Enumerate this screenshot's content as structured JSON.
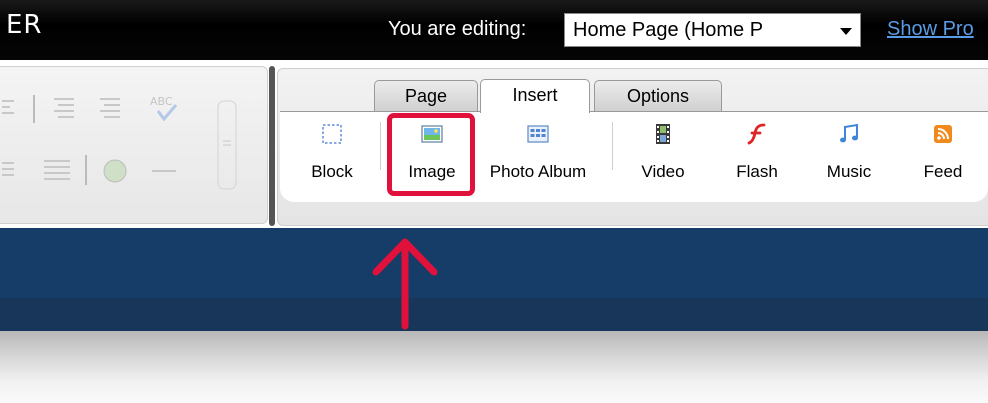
{
  "header": {
    "logo_fragment": "ER",
    "editing_label": "You are editing:",
    "page_select_value": "Home Page (Home P",
    "show_props_link": "Show Pro"
  },
  "ribbon": {
    "tabs": [
      {
        "label": "Page",
        "active": false
      },
      {
        "label": "Insert",
        "active": true
      },
      {
        "label": "Options",
        "active": false
      }
    ],
    "tools": [
      {
        "label": "Block",
        "icon": "block-icon"
      },
      {
        "label": "Image",
        "icon": "image-icon"
      },
      {
        "label": "Photo Album",
        "icon": "photo-album-icon"
      },
      {
        "label": "Video",
        "icon": "video-icon"
      },
      {
        "label": "Flash",
        "icon": "flash-icon"
      },
      {
        "label": "Music",
        "icon": "music-icon"
      },
      {
        "label": "Feed",
        "icon": "feed-icon"
      }
    ]
  },
  "annotation": {
    "highlight_target": "Image",
    "color": "#e0113a"
  },
  "colors": {
    "link": "#5a9be6",
    "blue_band": "#163c68"
  }
}
